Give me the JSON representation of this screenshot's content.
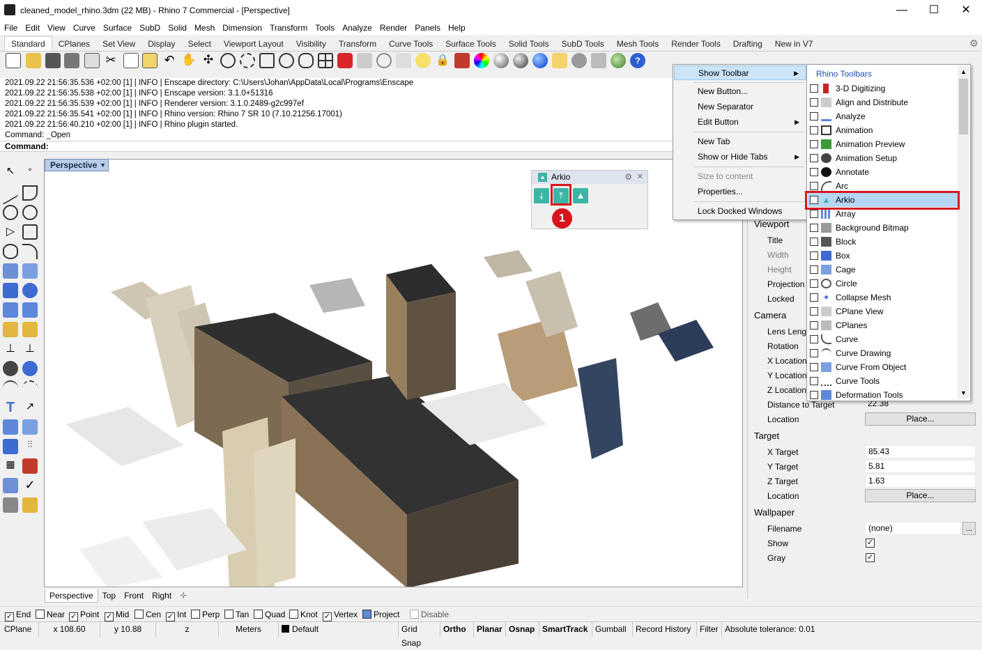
{
  "window": {
    "title": "cleaned_model_rhino.3dm (22 MB) - Rhino 7 Commercial - [Perspective]",
    "minimize": "—",
    "maximize": "☐",
    "close": "✕"
  },
  "menu": [
    "File",
    "Edit",
    "View",
    "Curve",
    "Surface",
    "SubD",
    "Solid",
    "Mesh",
    "Dimension",
    "Transform",
    "Tools",
    "Analyze",
    "Render",
    "Panels",
    "Help"
  ],
  "tabs": [
    "Standard",
    "CPlanes",
    "Set View",
    "Display",
    "Select",
    "Viewport Layout",
    "Visibility",
    "Transform",
    "Curve Tools",
    "Surface Tools",
    "Solid Tools",
    "SubD Tools",
    "Mesh Tools",
    "Render Tools",
    "Drafting",
    "New in V7"
  ],
  "command_history": [
    "2021.09.22 21:56:35.536 +02:00 [1] | INFO | Enscape directory: C:\\Users\\Johan\\AppData\\Local\\Programs\\Enscape",
    "2021.09.22 21:56:35.538 +02:00 [1] | INFO | Enscape version: 3.1.0+51316",
    "2021.09.22 21:56:35.539 +02:00 [1] | INFO | Renderer version: 3.1.0.2489-g2c997ef",
    "2021.09.22 21:56:35.541 +02:00 [1] | INFO | Rhino version: Rhino 7 SR 10 (7.10.21256.17001)",
    "2021.09.22 21:56:40.210 +02:00 [1] | INFO | Rhino plugin started.",
    "Command: _Open"
  ],
  "command_prompt": "Command:",
  "viewport": {
    "name": "Perspective",
    "tabs": [
      "Perspective",
      "Top",
      "Front",
      "Right"
    ],
    "add_tab": "✛"
  },
  "arkio_panel": {
    "title": "Arkio",
    "badge": "1"
  },
  "context_menu": {
    "items": [
      {
        "label": "Show Toolbar",
        "submenu": true
      },
      {
        "label": "New Button..."
      },
      {
        "label": "New Separator"
      },
      {
        "label": "Edit Button",
        "submenu": true
      },
      {
        "label": "New Tab"
      },
      {
        "label": "Show or Hide Tabs",
        "submenu": true
      },
      {
        "label": "Size to content"
      },
      {
        "label": "Properties..."
      },
      {
        "label": "Lock Docked Windows"
      }
    ],
    "arrow": "▶"
  },
  "toolbars_submenu": {
    "header": "Rhino Toolbars",
    "items": [
      "3-D Digitizing",
      "Align and Distribute",
      "Analyze",
      "Animation",
      "Animation Preview",
      "Animation Setup",
      "Annotate",
      "Arc",
      "Arkio",
      "Array",
      "Background Bitmap",
      "Block",
      "Box",
      "Cage",
      "Circle",
      "Collapse Mesh",
      "CPlane View",
      "CPlanes",
      "Curve",
      "Curve Drawing",
      "Curve From Object",
      "Curve Tools",
      "Deformation Tools"
    ],
    "selected": "Arkio"
  },
  "properties": {
    "viewport_header": "Viewport",
    "viewport_rows": [
      "Title",
      "Width",
      "Height",
      "Projection",
      "Locked"
    ],
    "camera_header": "Camera",
    "camera_rows": [
      "Lens Length",
      "Rotation",
      "X Location",
      "Y Location",
      "Z Location"
    ],
    "distance_label": "Distance to Target",
    "distance_value": "22.38",
    "location_label": "Location",
    "place_button": "Place...",
    "target_header": "Target",
    "target_rows": [
      {
        "label": "X Target",
        "value": "85.43"
      },
      {
        "label": "Y Target",
        "value": "5.81"
      },
      {
        "label": "Z Target",
        "value": "1.63"
      }
    ],
    "target_location": "Location",
    "wallpaper_header": "Wallpaper",
    "filename_label": "Filename",
    "filename_value": "(none)",
    "browse": "...",
    "show_label": "Show",
    "gray_label": "Gray",
    "check": "✓"
  },
  "osnaps": [
    {
      "label": "End",
      "checked": true
    },
    {
      "label": "Near",
      "checked": false
    },
    {
      "label": "Point",
      "checked": true
    },
    {
      "label": "Mid",
      "checked": true
    },
    {
      "label": "Cen",
      "checked": false
    },
    {
      "label": "Int",
      "checked": true
    },
    {
      "label": "Perp",
      "checked": false
    },
    {
      "label": "Tan",
      "checked": false
    },
    {
      "label": "Quad",
      "checked": false
    },
    {
      "label": "Knot",
      "checked": false
    },
    {
      "label": "Vertex",
      "checked": true
    },
    {
      "label": "Project",
      "checked": false
    },
    {
      "label": "Disable",
      "checked": false
    }
  ],
  "status": {
    "cplane": "CPlane",
    "x": "x 108.60",
    "y": "y 10.88",
    "z": "z",
    "units": "Meters",
    "layer": "Default",
    "grid_snap": "Grid Snap",
    "ortho": "Ortho",
    "planar": "Planar",
    "osnap": "Osnap",
    "smarttrack": "SmartTrack",
    "gumball": "Gumball",
    "record_history": "Record History",
    "filter": "Filter",
    "tolerance": "Absolute tolerance: 0.01"
  }
}
